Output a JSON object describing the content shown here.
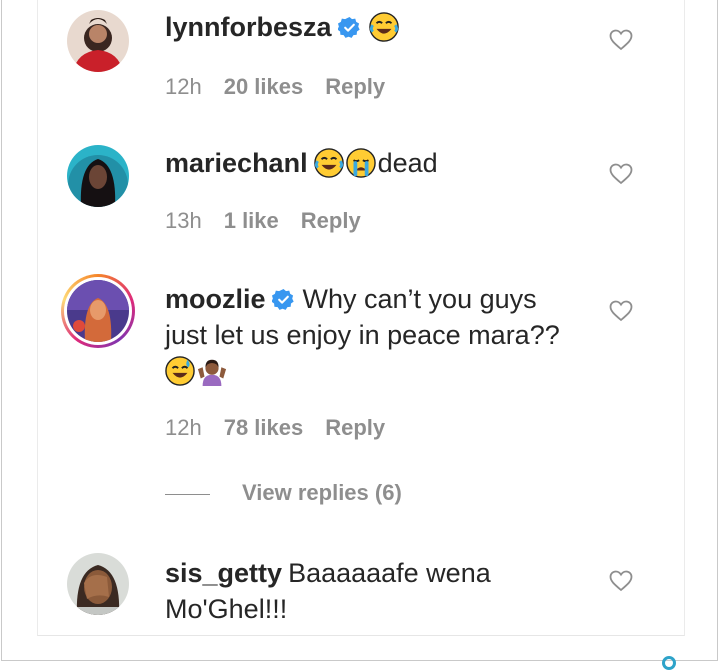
{
  "comments": [
    {
      "username": "lynnforbesza",
      "verified": true,
      "text": "",
      "emojis": [
        "joy-emoji"
      ],
      "time": "12h",
      "likes": "20 likes",
      "reply": "Reply"
    },
    {
      "username": "mariechanl",
      "verified": false,
      "text": "dead",
      "emojis": [
        "joy-emoji",
        "sob-emoji"
      ],
      "time": "13h",
      "likes": "1 like",
      "reply": "Reply"
    },
    {
      "username": "moozlie",
      "verified": true,
      "text_line1": "Why can’t you guys",
      "text_line2": "just let us enjoy in peace mara??",
      "emojis": [
        "sweat-smile-emoji",
        "person-shrugging-emoji"
      ],
      "time": "12h",
      "likes": "78 likes",
      "reply": "Reply",
      "view_replies": "View replies (6)"
    },
    {
      "username": "sis_getty",
      "verified": false,
      "text_line1": "Baaaaaafe wena",
      "text_line2": "Mo'Ghel!!!"
    }
  ],
  "colors": {
    "primary_text": "#262626",
    "secondary_text": "#8e8e8e",
    "verified_blue": "#3897f0",
    "story_ring": [
      "#f58529",
      "#dd2a7b",
      "#8134af",
      "#feda77"
    ]
  },
  "icons": [
    "heart-outline-icon",
    "verified-badge-icon"
  ]
}
